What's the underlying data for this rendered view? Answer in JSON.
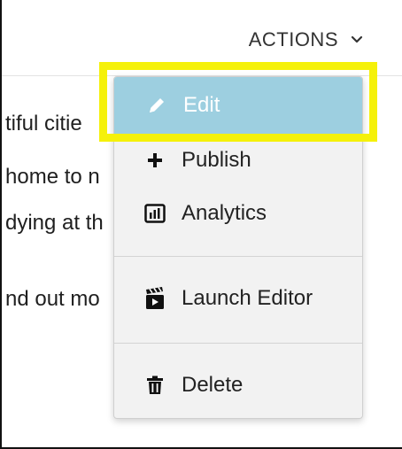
{
  "header": {
    "actions_label": "ACTIONS"
  },
  "content": {
    "lines": [
      "tiful citie",
      "home to n",
      "dying at th",
      "nd out mo"
    ]
  },
  "menu": {
    "items": [
      {
        "label": "Edit",
        "icon": "pencil-icon"
      },
      {
        "label": "Publish",
        "icon": "plus-icon"
      },
      {
        "label": "Analytics",
        "icon": "bar-chart-icon"
      },
      {
        "label": "Launch Editor",
        "icon": "clapperboard-icon"
      },
      {
        "label": "Delete",
        "icon": "trash-icon"
      }
    ]
  },
  "colors": {
    "highlight": "#f5f10a",
    "active_item_bg": "#9dcfe0",
    "menu_bg": "#f2f2f2"
  }
}
